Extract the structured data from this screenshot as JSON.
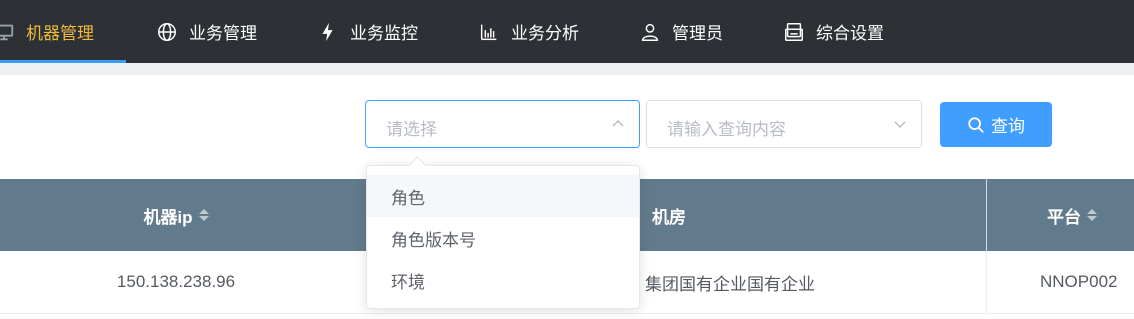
{
  "nav": {
    "items": [
      {
        "label": "机器管理",
        "icon": "monitor-icon",
        "active": true
      },
      {
        "label": "业务管理",
        "icon": "globe-icon"
      },
      {
        "label": "业务监控",
        "icon": "lightning-icon"
      },
      {
        "label": "业务分析",
        "icon": "bar-chart-icon"
      },
      {
        "label": "管理员",
        "icon": "user-icon"
      },
      {
        "label": "综合设置",
        "icon": "settings-doc-icon"
      }
    ],
    "active_color": "#f0b93a",
    "background": "#2d3035"
  },
  "filters": {
    "select_placeholder": "请选择",
    "query_placeholder": "请输入查询内容",
    "search_label": "查询",
    "options": [
      "角色",
      "角色版本号",
      "环境"
    ],
    "hovered_option": "角色"
  },
  "table": {
    "columns": [
      {
        "label": "机器ip",
        "sortable": true
      },
      {
        "label": "机房",
        "sortable": false
      },
      {
        "label": "平台",
        "sortable": true
      }
    ],
    "rows": [
      {
        "ip": "150.138.238.96",
        "room": "集团国有企业国有企业",
        "platform": "NNOP002"
      }
    ],
    "header_color": "#627b8c"
  },
  "accent": "#409eff"
}
